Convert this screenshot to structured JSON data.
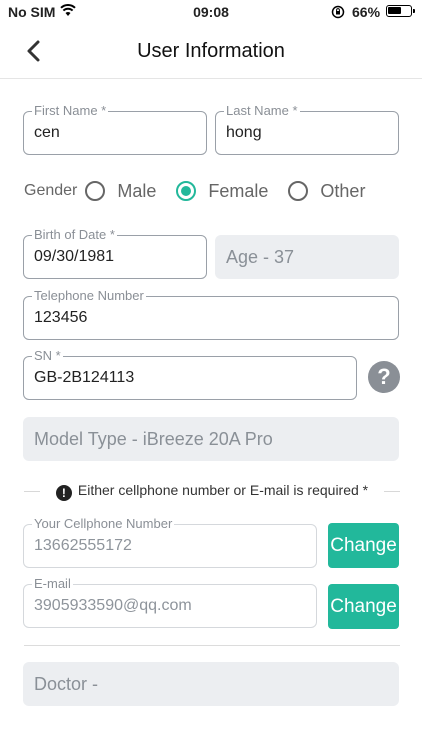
{
  "status_bar": {
    "carrier": "No SIM",
    "time": "09:08",
    "battery_percent": "66%",
    "battery_level": 0.66
  },
  "nav": {
    "title": "User Information"
  },
  "form": {
    "first_name": {
      "label": "First Name *",
      "value": "cen"
    },
    "last_name": {
      "label": "Last Name *",
      "value": "hong"
    },
    "gender": {
      "label": "Gender",
      "options": [
        "Male",
        "Female",
        "Other"
      ],
      "selected": "Female"
    },
    "birth_date": {
      "label": "Birth of Date *",
      "value": "09/30/1981"
    },
    "age": "Age - 37",
    "telephone": {
      "label": "Telephone Number",
      "value": "123456"
    },
    "sn": {
      "label": "SN *",
      "value": "GB-2B124113"
    },
    "model_type": "Model Type - iBreeze 20A Pro",
    "notice": "Either cellphone number or E-mail is required *",
    "cellphone": {
      "label": "Your Cellphone Number",
      "value": "13662555172",
      "button": "Change"
    },
    "email": {
      "label": "E-mail",
      "value": "3905933590@qq.com",
      "button": "Change"
    },
    "doctor": "Doctor -"
  },
  "colors": {
    "accent": "#22b89b",
    "filled_bg": "#eceef1",
    "border": "#9aa0a8"
  }
}
